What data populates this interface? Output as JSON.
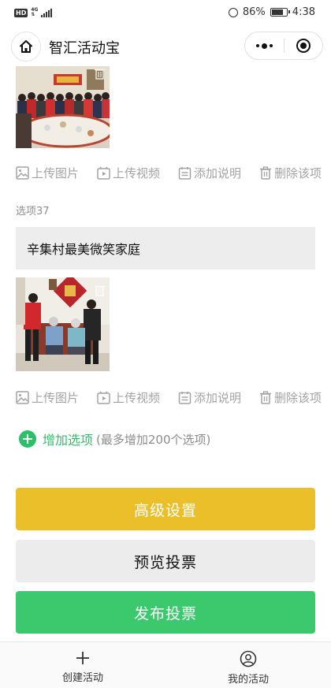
{
  "status_bar": {
    "hd_badge": "HD",
    "network_top": "4G",
    "network_bottom": "⇅",
    "battery": "86%",
    "time": "4:38"
  },
  "header": {
    "title": "智汇活动宝",
    "home_icon": "home-icon",
    "more_icon": "more-dots-icon",
    "close_icon": "close-miniprogram-icon"
  },
  "options": [
    {
      "image": "group-photo-banquet",
      "actions": [
        "上传图片",
        "上传视频",
        "添加说明",
        "删除该项"
      ]
    },
    {
      "label": "选项37",
      "value": "辛集村最美微笑家庭",
      "image": "family-photo",
      "actions": [
        "上传图片",
        "上传视频",
        "添加说明",
        "删除该项"
      ]
    }
  ],
  "add_option": {
    "label": "增加选项",
    "hint": "(最多增加200个选项)"
  },
  "buttons": {
    "advanced": "高级设置",
    "preview": "预览投票",
    "publish": "发布投票"
  },
  "tabbar": [
    {
      "label": "创建活动",
      "icon": "plus-icon"
    },
    {
      "label": "我的活动",
      "icon": "user-icon"
    }
  ],
  "colors": {
    "accent_green": "#3cc96e",
    "accent_yellow": "#ebbf2a",
    "muted_gray": "#a3a3a3",
    "input_bg": "#ededed"
  }
}
